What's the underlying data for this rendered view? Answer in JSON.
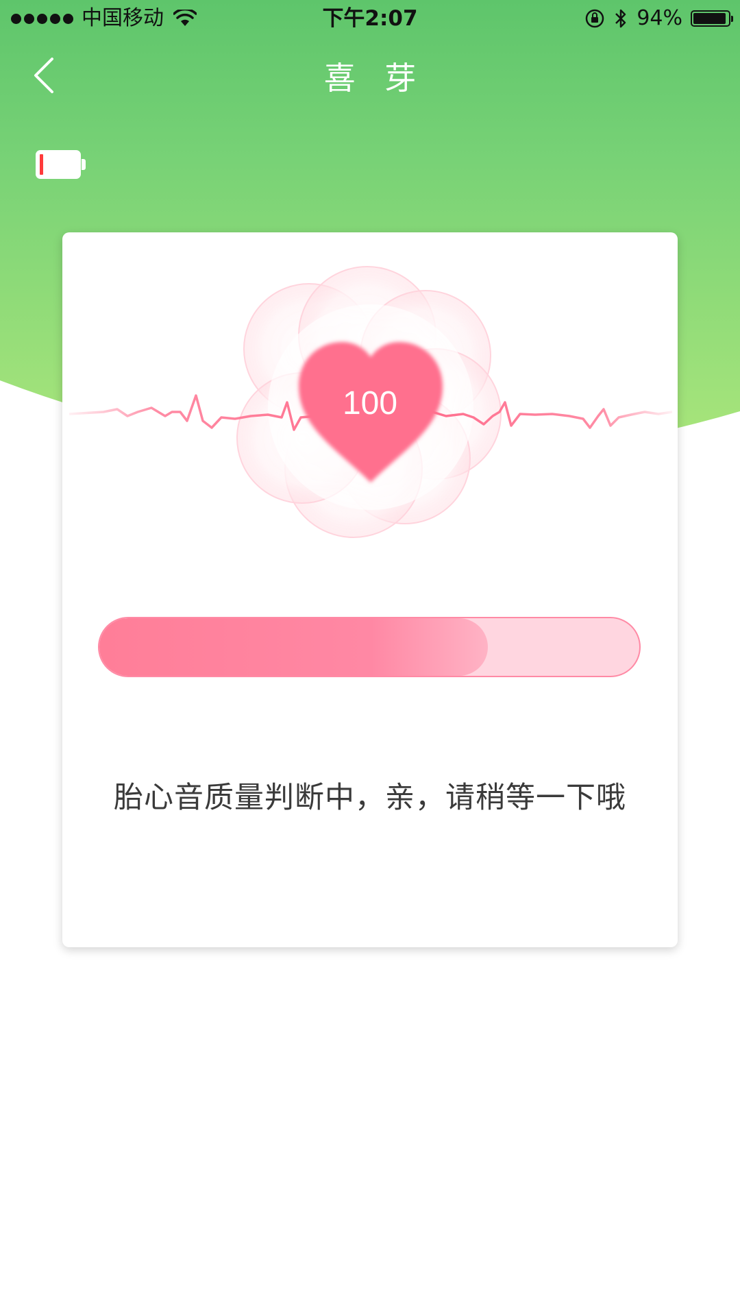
{
  "status_bar": {
    "carrier": "中国移动",
    "time": "下午2:07",
    "battery_percent": "94%",
    "battery_level": 0.94,
    "icons": [
      "signal-dots",
      "wifi-icon",
      "orientation-lock-icon",
      "bluetooth-icon",
      "battery-icon"
    ]
  },
  "nav": {
    "back_icon": "chevron-left-icon",
    "title": "喜 芽"
  },
  "device_battery": {
    "icon": "low-battery-icon",
    "level": 0.05,
    "level_color": "#ff3b3b"
  },
  "monitor": {
    "heart_rate": "100",
    "heart_color": "#ff6f8e",
    "progress": 0.72,
    "message": "胎心音质量判断中，亲，请稍等一下哦"
  },
  "colors": {
    "header_top": "#5ec56b",
    "header_bottom": "#a6e37a",
    "accent_pink": "#ff7e98",
    "text": "#3a3a3a"
  }
}
